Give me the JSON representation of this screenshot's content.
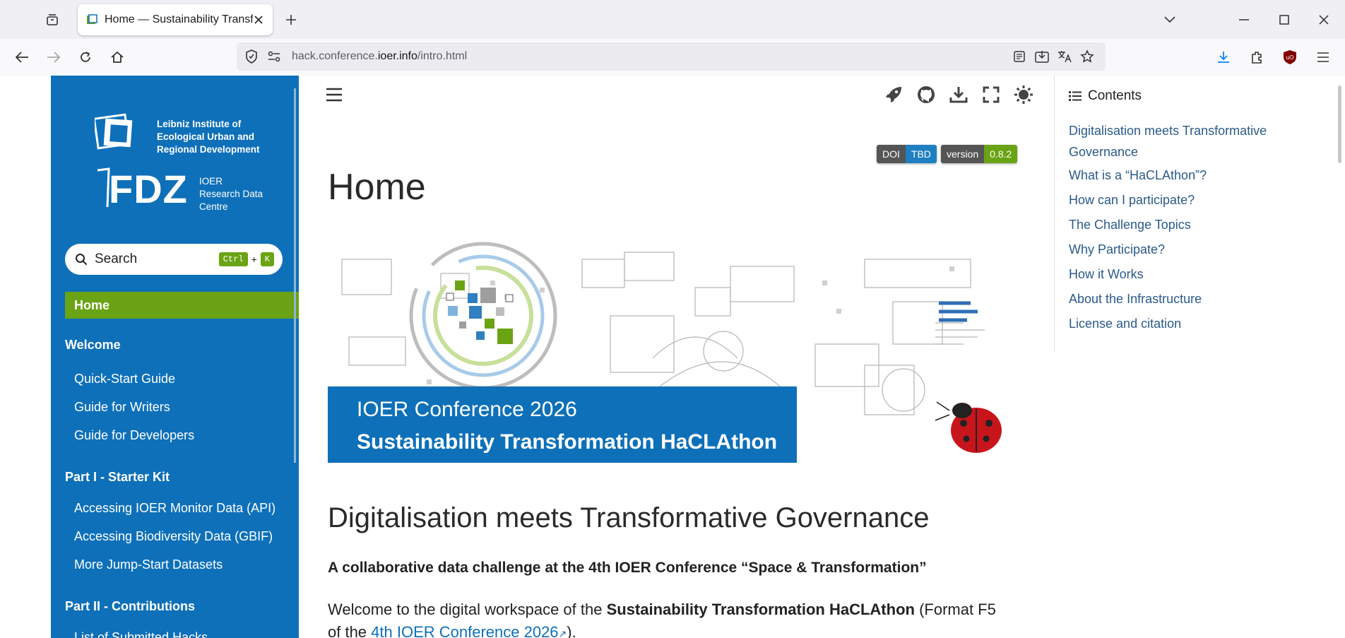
{
  "browser": {
    "tab_title": "Home — Sustainability Transfor",
    "url_prefix": "hack.conference.",
    "url_domain": "ioer.info",
    "url_path": "/intro.html"
  },
  "sidebar": {
    "org_name_line1": "Leibniz Institute of",
    "org_name_line2": "Ecological Urban and",
    "org_name_line3": "Regional Development",
    "fdz_mark": "FDZ",
    "fdz_line1": "IOER",
    "fdz_line2": "Research Data",
    "fdz_line3": "Centre",
    "search_placeholder": "Search",
    "search_key1": "Ctrl",
    "search_plus": "+",
    "search_key2": "K",
    "home": "Home",
    "caption_welcome": "Welcome",
    "welcome_items": [
      "Quick-Start Guide",
      "Guide for Writers",
      "Guide for Developers"
    ],
    "caption_part1": "Part I - Starter Kit",
    "part1_items": [
      "Accessing IOER Monitor Data (API)",
      "Accessing Biodiversity Data (GBIF)",
      "More Jump-Start Datasets"
    ],
    "caption_part2": "Part II - Contributions",
    "part2_items": [
      "List of Submitted Hacks"
    ]
  },
  "badges": {
    "doi_label": "DOI",
    "doi_value": "TBD",
    "version_label": "version",
    "version_value": "0.8.2"
  },
  "main": {
    "page_title": "Home",
    "banner_line1": "IOER Conference 2026",
    "banner_line2": "Sustainability Transformation HaCLAthon",
    "section_title": "Digitalisation meets Transformative Governance",
    "lead": "A collaborative data challenge at the 4th IOER Conference “Space & Transformation”",
    "para_text1": "Welcome to the digital workspace of the ",
    "para_bold": "Sustainability Transformation HaCLAthon",
    "para_text2": " (Format F5 of the ",
    "para_link": "4th IOER Conference 2026",
    "para_text3": ")."
  },
  "toc": {
    "title": "Contents",
    "items": [
      "Digitalisation meets Transformative Governance",
      "What is a “HaCLAthon”?",
      "How can I participate?",
      "The Challenge Topics",
      "Why Participate?",
      "How it Works",
      "About the Infrastructure",
      "License and citation"
    ]
  },
  "colors": {
    "sidebar_blue": "#0e70b9",
    "accent_green": "#6aa313",
    "doi_blue": "#1e7fc1",
    "badge_dark": "#555555"
  }
}
